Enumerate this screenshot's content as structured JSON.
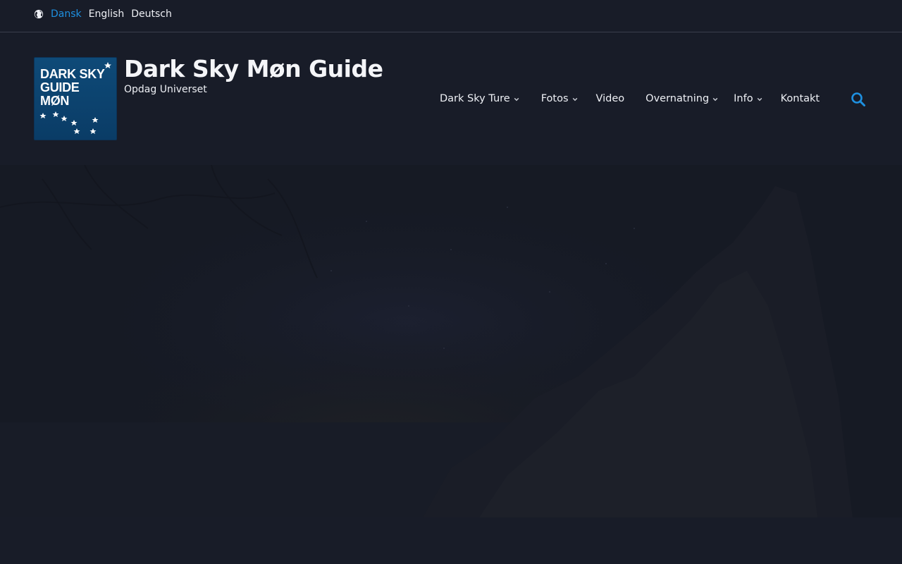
{
  "languages": {
    "items": [
      {
        "label": "Dansk",
        "active": true
      },
      {
        "label": "English",
        "active": false
      },
      {
        "label": "Deutsch",
        "active": false
      }
    ]
  },
  "site": {
    "logo_lines": [
      "DARK SKY",
      "GUIDE",
      "MØN"
    ],
    "title": "Dark Sky Møn Guide",
    "tagline": "Opdag Universet"
  },
  "nav": {
    "items": [
      {
        "label": "Dark Sky Ture",
        "has_dropdown": true
      },
      {
        "label": "Fotos",
        "has_dropdown": true
      },
      {
        "label": "Video",
        "has_dropdown": false
      },
      {
        "label": "Overnatning",
        "has_dropdown": true
      },
      {
        "label": "Info",
        "has_dropdown": true
      },
      {
        "label": "Kontakt",
        "has_dropdown": false
      }
    ]
  },
  "colors": {
    "background": "#181c28",
    "accent": "#1e90e0",
    "logo_blue": "#0e4a78"
  },
  "icons": {
    "globe": "globe-icon",
    "search": "search-icon",
    "chevron": "chevron-down-icon"
  }
}
